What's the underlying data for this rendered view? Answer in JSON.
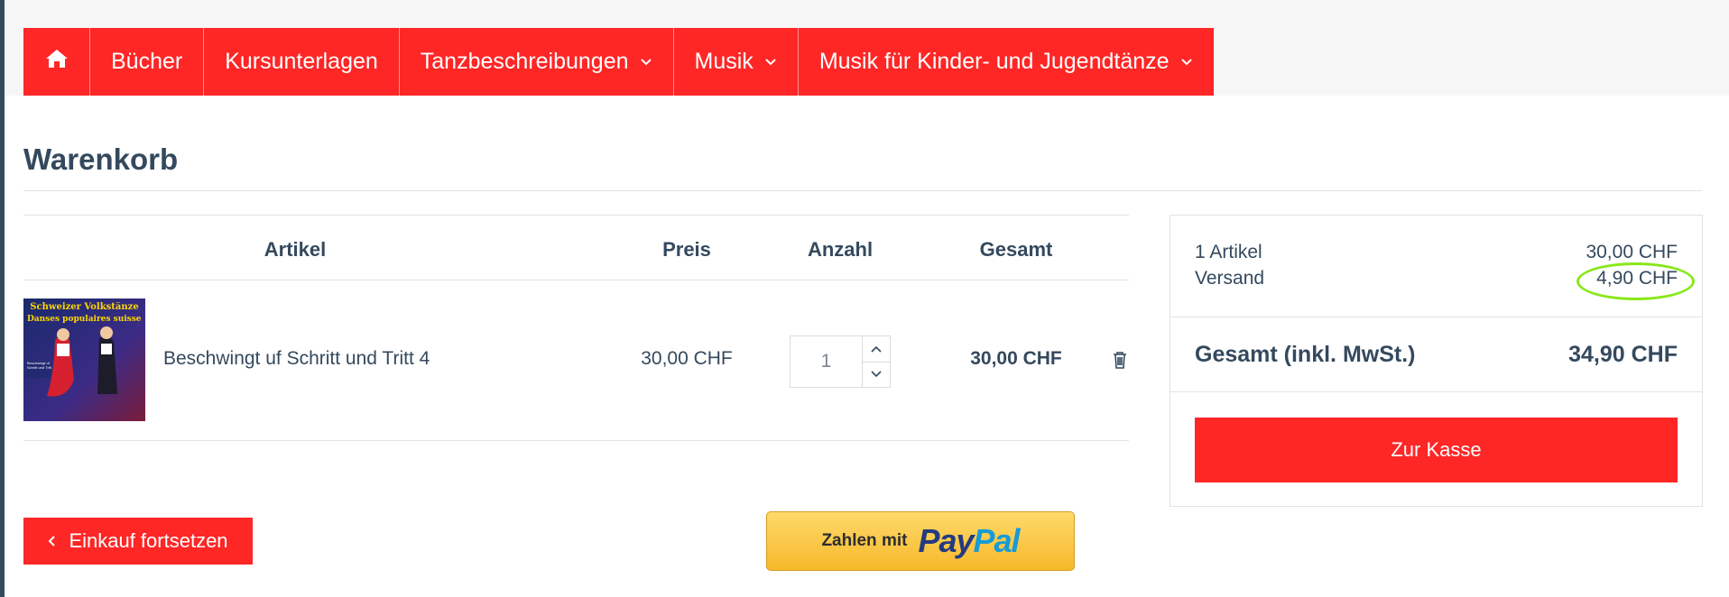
{
  "nav": {
    "home_icon": "home-icon",
    "items": [
      {
        "label": "Bücher",
        "has_dropdown": false
      },
      {
        "label": "Kursunterlagen",
        "has_dropdown": false
      },
      {
        "label": "Tanzbeschreibungen",
        "has_dropdown": true
      },
      {
        "label": "Musik",
        "has_dropdown": true
      },
      {
        "label": "Musik für Kinder- und Jugendtänze",
        "has_dropdown": true
      }
    ]
  },
  "page": {
    "title": "Warenkorb"
  },
  "cart": {
    "headers": {
      "item": "Artikel",
      "price": "Preis",
      "quantity": "Anzahl",
      "total": "Gesamt"
    },
    "rows": [
      {
        "cover_title": "Schweizer Volkstänze",
        "cover_subtitle": "Danses populaires suisses",
        "cover_label": "Beschwingt uf Schritt und Tritt",
        "name": "Beschwingt uf Schritt und Tritt 4",
        "price": "30,00 CHF",
        "quantity": "1",
        "total": "30,00 CHF"
      }
    ]
  },
  "summary": {
    "items_label": "1 Artikel",
    "items_value": "30,00 CHF",
    "shipping_label": "Versand",
    "shipping_value": "4,90 CHF",
    "total_label": "Gesamt (inkl. MwSt.)",
    "total_value": "34,90 CHF",
    "checkout_label": "Zur Kasse"
  },
  "actions": {
    "continue_label": "Einkauf fortsetzen",
    "paypal_label": "Zahlen mit",
    "paypal_logo_pay": "Pay",
    "paypal_logo_pal": "Pal"
  },
  "colors": {
    "accent": "#ff2626",
    "text": "#34495e",
    "highlight": "#88e81b"
  }
}
